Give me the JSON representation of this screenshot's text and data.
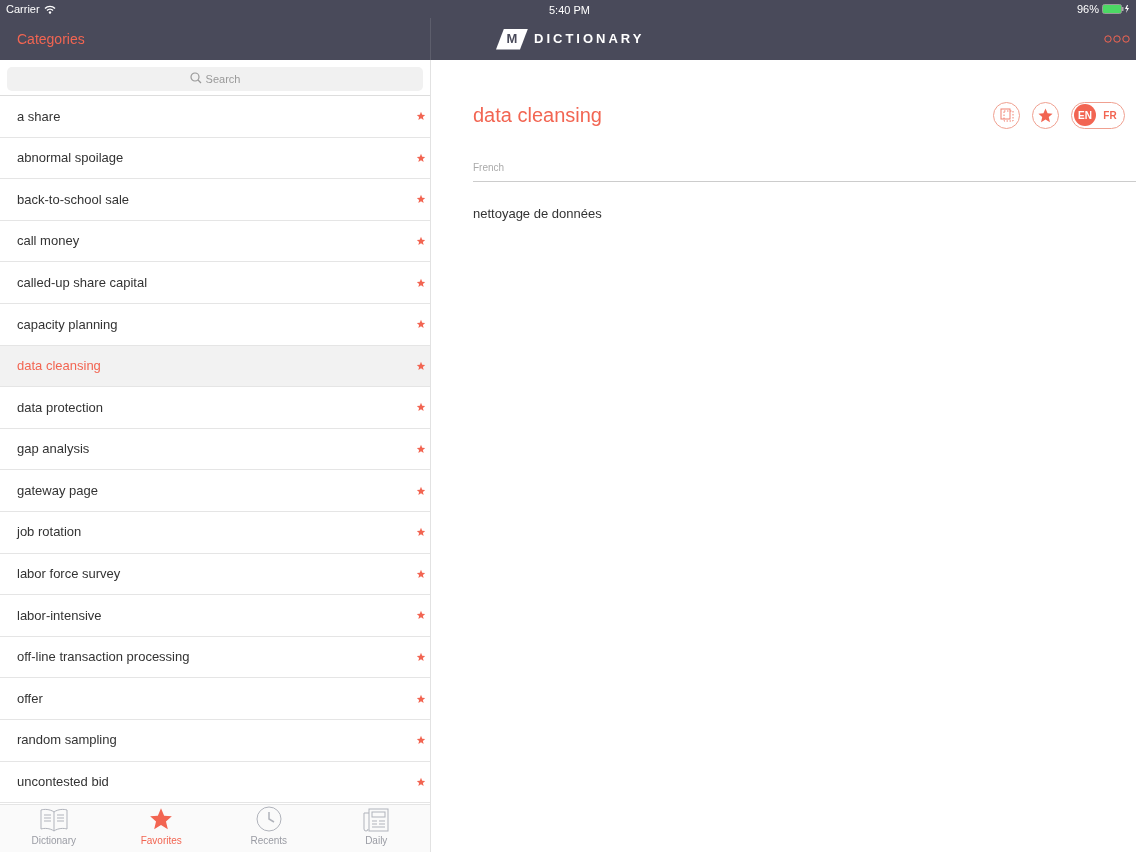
{
  "status_bar": {
    "carrier": "Carrier",
    "time": "5:40 PM",
    "battery": "96%"
  },
  "sidebar": {
    "title": "Categories",
    "search": {
      "placeholder": "Search"
    },
    "items": [
      {
        "label": "a share",
        "selected": false,
        "starred": true
      },
      {
        "label": "abnormal spoilage",
        "selected": false,
        "starred": true
      },
      {
        "label": "back-to-school sale",
        "selected": false,
        "starred": true
      },
      {
        "label": "call money",
        "selected": false,
        "starred": true
      },
      {
        "label": "called-up share capital",
        "selected": false,
        "starred": true
      },
      {
        "label": "capacity planning",
        "selected": false,
        "starred": true
      },
      {
        "label": "data cleansing",
        "selected": true,
        "starred": true
      },
      {
        "label": "data protection",
        "selected": false,
        "starred": true
      },
      {
        "label": "gap analysis",
        "selected": false,
        "starred": true
      },
      {
        "label": "gateway page",
        "selected": false,
        "starred": true
      },
      {
        "label": "job rotation",
        "selected": false,
        "starred": true
      },
      {
        "label": "labor force survey",
        "selected": false,
        "starred": true
      },
      {
        "label": "labor-intensive",
        "selected": false,
        "starred": true
      },
      {
        "label": "off-line transaction processing",
        "selected": false,
        "starred": true
      },
      {
        "label": "offer",
        "selected": false,
        "starred": true
      },
      {
        "label": "random sampling",
        "selected": false,
        "starred": true
      },
      {
        "label": "uncontested bid",
        "selected": false,
        "starred": true
      }
    ]
  },
  "tab_bar": [
    {
      "label": "Dictionary",
      "selected": false,
      "kind": "book"
    },
    {
      "label": "Favorites",
      "selected": true,
      "kind": "star"
    },
    {
      "label": "Recents",
      "selected": false,
      "kind": "clock"
    },
    {
      "label": "Daily",
      "selected": false,
      "kind": "newspaper"
    }
  ],
  "header": {
    "logo_letter": "M",
    "logo_text": "DICTIONARY"
  },
  "entry": {
    "term": "data cleansing",
    "favorite": true,
    "languages": [
      {
        "label": "EN",
        "selected": true
      },
      {
        "label": "FR",
        "selected": false
      }
    ],
    "section_label": "French",
    "translation": "nettoyage de données"
  }
}
